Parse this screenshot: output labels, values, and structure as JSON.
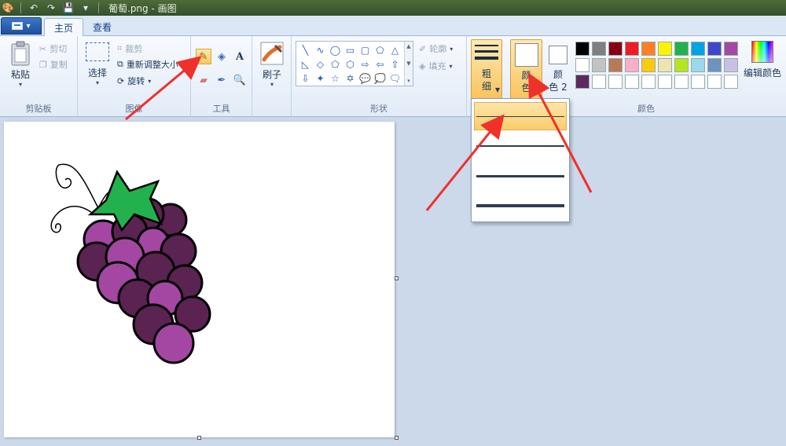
{
  "titlebar": {
    "title": "葡萄.png - 画图",
    "icons": [
      "paint-app-icon",
      "undo-icon",
      "redo-icon",
      "save-icon",
      "customize-qat-icon"
    ]
  },
  "tabs": [
    {
      "label": "主页",
      "active": true
    },
    {
      "label": "查看",
      "active": false
    }
  ],
  "clipboard": {
    "paste": "粘贴",
    "cut": "剪切",
    "copy": "复制",
    "group": "剪贴板"
  },
  "image": {
    "select": "选择",
    "crop": "裁剪",
    "resize": "重新调整大小",
    "rotate": "旋转",
    "group": "图像"
  },
  "tools": {
    "group": "工具",
    "active_tool": "pencil"
  },
  "brushes": {
    "label": "刷子"
  },
  "shapes": {
    "group": "形状",
    "outline": "轮廓",
    "fill": "填充",
    "items": [
      "╲",
      "∿",
      "◯",
      "▭",
      "▢",
      "⬠",
      "△",
      "◺",
      "◇",
      "⬠",
      "⬡",
      "⇨",
      "⇦",
      "⇧",
      "⇩",
      "✦",
      "☆",
      "✡",
      "💬",
      "💭",
      "🗨"
    ]
  },
  "size": {
    "label_1": "粗",
    "label_2": "细",
    "options": [
      {
        "thickness": 1,
        "selected": true
      },
      {
        "thickness": 2,
        "selected": false
      },
      {
        "thickness": 3,
        "selected": false
      },
      {
        "thickness": 4,
        "selected": false
      }
    ]
  },
  "colors": {
    "group": "颜色",
    "color1_1": "颜",
    "color1_2": "色",
    "color2_1": "颜",
    "color2_2": "色 2",
    "color1_value": "#ffffff",
    "color2_value": "#ffffff",
    "edit": "编辑颜色",
    "palette": [
      "#000000",
      "#7f7f7f",
      "#880015",
      "#ed1c24",
      "#ff7f27",
      "#fff200",
      "#22b14c",
      "#00a2e8",
      "#3f48cc",
      "#a349a4",
      "#ffffff",
      "#c3c3c3",
      "#b97a57",
      "#ffaec9",
      "#ffc90e",
      "#efe4b0",
      "#b5e61d",
      "#99d9ea",
      "#7092be",
      "#c8bfe7",
      "#5b2a5e",
      "#ffffff",
      "#ffffff",
      "#ffffff",
      "#ffffff",
      "#ffffff",
      "#ffffff",
      "#ffffff",
      "#ffffff",
      "#ffffff"
    ]
  },
  "drawing": {
    "grape_dark": "#5a2352",
    "grape_light": "#a347a2",
    "leaf": "#22b14c"
  }
}
